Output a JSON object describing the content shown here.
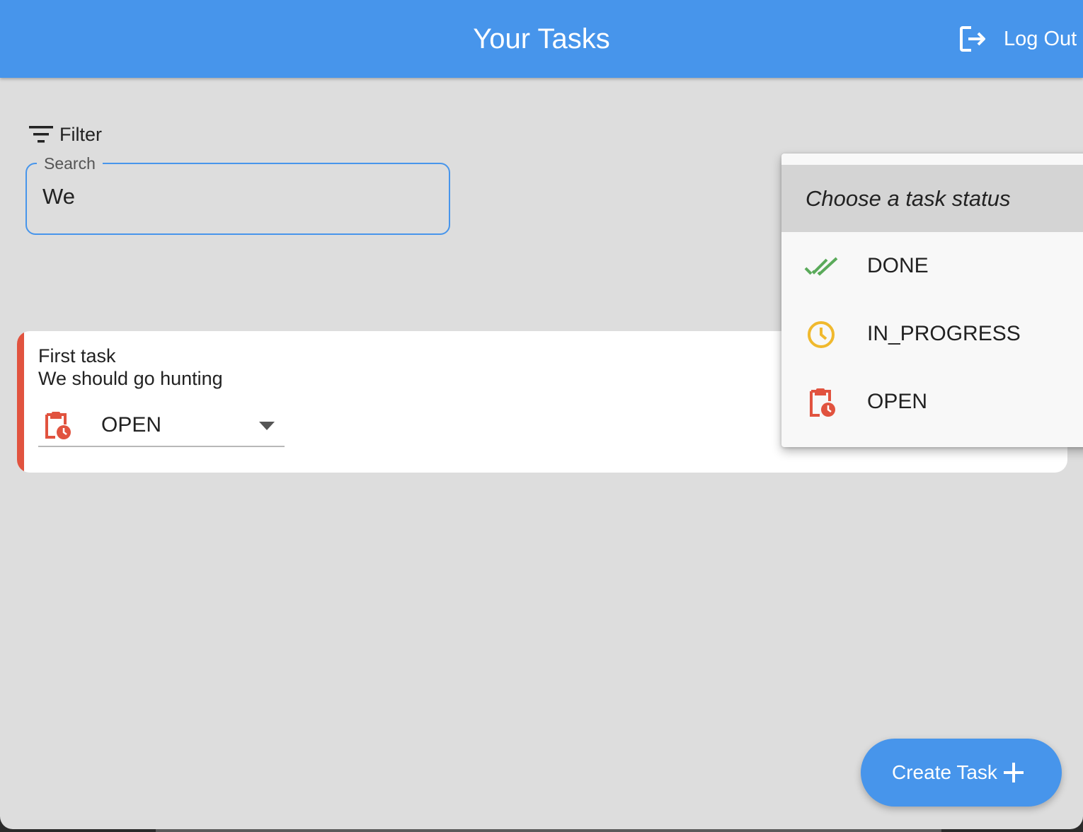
{
  "appbar": {
    "title": "Your Tasks",
    "logout_label": "Log Out"
  },
  "filter": {
    "label": "Filter"
  },
  "search": {
    "label": "Search",
    "value": "We"
  },
  "tasks": [
    {
      "title": "First task",
      "description": "We should go hunting",
      "status": "OPEN",
      "status_icon": "clipboard-clock-icon"
    }
  ],
  "status_dropdown": {
    "header": "Choose a task status",
    "options": [
      {
        "label": "DONE",
        "icon": "double-check-icon",
        "color": "#5aaa5a"
      },
      {
        "label": "IN_PROGRESS",
        "icon": "clock-icon",
        "color": "#f0b92e"
      },
      {
        "label": "OPEN",
        "icon": "clipboard-clock-icon",
        "color": "#e1533f"
      }
    ]
  },
  "fab": {
    "label": "Create Task",
    "icon": "plus-icon"
  },
  "colors": {
    "primary": "#4795eb",
    "open": "#e1533f",
    "done": "#5aaa5a",
    "in_progress": "#f0b92e"
  }
}
